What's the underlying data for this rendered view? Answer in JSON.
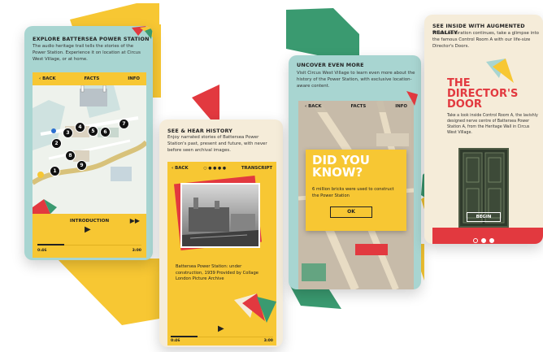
{
  "card1": {
    "heading": "EXPLORE BATTERSEA POWER STATION",
    "body": "The audio heritage trail tells the stories of the Power Station. Experience it on location at Circus West Village, or at home.",
    "nav": {
      "back": "BACK",
      "title": "FACTS",
      "info": "INFO"
    },
    "map_pins": [
      "1",
      "2",
      "3",
      "4",
      "5",
      "6",
      "7",
      "8",
      "9"
    ],
    "player": {
      "title": "INTRODUCTION",
      "elapsed": "0:46",
      "total": "3:00",
      "progress": 0.26
    }
  },
  "card2": {
    "heading": "SEE & HEAR HISTORY",
    "body": "Enjoy narrated stories of Battersea Power Station's past, present and future, with never before seen archival images.",
    "nav": {
      "back": "BACK",
      "pager": "○ ● ● ● ●",
      "transcript": "TRANSCRIPT"
    },
    "caption": "Battersea Power Station: under construction, 1939 Provided by Collage London Picture Archive",
    "player": {
      "elapsed": "0:46",
      "total": "3:00",
      "progress": 0.26
    }
  },
  "card3": {
    "heading": "UNCOVER EVEN MORE",
    "body": "Visit Circus West Village to learn even more about the history of the Power Station, with exclusive location-aware content.",
    "nav": {
      "back": "BACK",
      "title": "FACTS",
      "info": "INFO"
    },
    "modal": {
      "title_line1": "DID YOU",
      "title_line2": "KNOW?",
      "text": "6 million bricks were used to construct the Power Station",
      "ok": "OK"
    }
  },
  "card4": {
    "heading": "SEE INSIDE WITH AUGMENTED REALITY",
    "body": "Whilst restoration continues, take a glimpse into the famous Control Room A with our life-size Director's Doors.",
    "title_line1": "THE",
    "title_line2": "DIRECTOR'S",
    "title_line3": "DOOR",
    "text": "Take a look inside Control Room A, the lavishly designed nerve centre of Battersea Power Station A, from the Heritage Wall in Circus West Village.",
    "begin": "BEGIN"
  },
  "colors": {
    "yellow": "#f7c733",
    "teal": "#a8d5d1",
    "cream": "#f5ecd9",
    "red": "#e2393f",
    "green": "#3a9a70"
  }
}
